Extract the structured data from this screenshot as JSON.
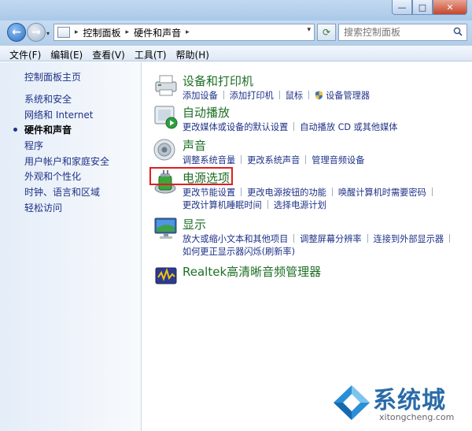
{
  "window": {
    "minimize_glyph": "—",
    "maximize_glyph": "□",
    "close_glyph": "✕"
  },
  "nav": {
    "back_glyph": "←",
    "forward_glyph": "→",
    "dropdown_glyph": "▾"
  },
  "address": {
    "breadcrumb": [
      "控制面板",
      "硬件和声音"
    ],
    "separator": "▸",
    "dropdown_glyph": "▾",
    "refresh_glyph": "⟳"
  },
  "search": {
    "placeholder": "搜索控制面板"
  },
  "menubar": {
    "items": [
      "文件(F)",
      "编辑(E)",
      "查看(V)",
      "工具(T)",
      "帮助(H)"
    ]
  },
  "sidebar": {
    "home": "控制面板主页",
    "items": [
      {
        "label": "系统和安全",
        "active": false
      },
      {
        "label": "网络和 Internet",
        "active": false
      },
      {
        "label": "硬件和声音",
        "active": true
      },
      {
        "label": "程序",
        "active": false
      },
      {
        "label": "用户帐户和家庭安全",
        "active": false
      },
      {
        "label": "外观和个性化",
        "active": false
      },
      {
        "label": "时钟、语言和区域",
        "active": false
      },
      {
        "label": "轻松访问",
        "active": false
      }
    ]
  },
  "categories": [
    {
      "title": "设备和打印机",
      "icon": "printer-icon",
      "links": [
        "添加设备",
        "添加打印机",
        "鼠标",
        "设备管理器"
      ]
    },
    {
      "title": "自动播放",
      "icon": "autoplay-icon",
      "links": [
        "更改媒体或设备的默认设置",
        "自动播放 CD 或其他媒体"
      ]
    },
    {
      "title": "声音",
      "icon": "speaker-icon",
      "links": [
        "调整系统音量",
        "更改系统声音",
        "管理音频设备"
      ]
    },
    {
      "title": "电源选项",
      "icon": "power-options-icon",
      "highlighted": true,
      "links": [
        "更改节能设置",
        "更改电源按钮的功能",
        "唤醒计算机时需要密码",
        "更改计算机睡眠时间",
        "选择电源计划"
      ]
    },
    {
      "title": "显示",
      "icon": "display-icon",
      "links": [
        "放大或缩小文本和其他项目",
        "调整屏幕分辨率",
        "连接到外部显示器",
        "如何更正显示器闪烁(刷新率)"
      ]
    },
    {
      "title": "Realtek高清晰音频管理器",
      "icon": "realtek-audio-icon",
      "links": []
    }
  ],
  "watermark": {
    "brand": "系统城",
    "url": "xitongcheng.com"
  },
  "colors": {
    "category_title": "#1e6f26",
    "link": "#1e3287",
    "highlight_box": "#e01e1e"
  }
}
